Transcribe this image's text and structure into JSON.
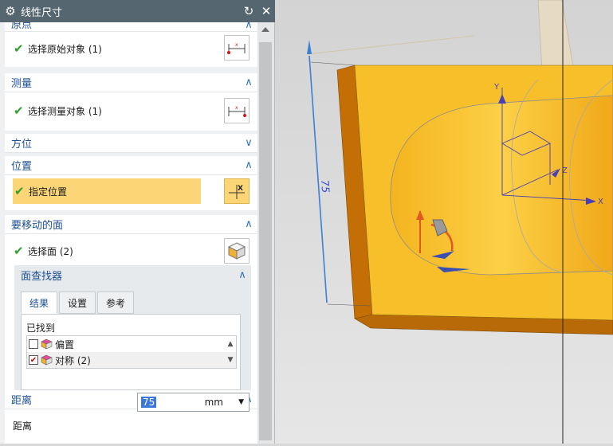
{
  "dialog": {
    "title": "线性尺寸",
    "sections": {
      "origin": {
        "title": "原点",
        "row_label": "选择原始对象 (1)"
      },
      "measure": {
        "title": "测量",
        "row_label": "选择测量对象 (1)"
      },
      "orientation": {
        "title": "方位"
      },
      "position": {
        "title": "位置",
        "row_label": "指定位置"
      },
      "faces": {
        "title": "要移动的面",
        "row_label": "选择面 (2)"
      },
      "distance": {
        "title": "距离",
        "label": "距离",
        "value": "75",
        "unit": "mm"
      }
    },
    "face_finder": {
      "title": "面查找器",
      "tabs": [
        "结果",
        "设置",
        "参考"
      ],
      "found_label": "已找到",
      "items": [
        {
          "label": "偏置",
          "checked": false
        },
        {
          "label": "对称 (2)",
          "checked": true
        }
      ]
    }
  },
  "viewport": {
    "dimension_text": "75",
    "axes": {
      "x": "X",
      "y": "Y",
      "z": "Z"
    }
  },
  "colors": {
    "titlebar": "#556670",
    "section_title": "#1d4f91",
    "highlight": "#fcd676",
    "check": "#2f9e2f",
    "model_face": "#f7c02a",
    "model_edge": "#c46f06"
  }
}
